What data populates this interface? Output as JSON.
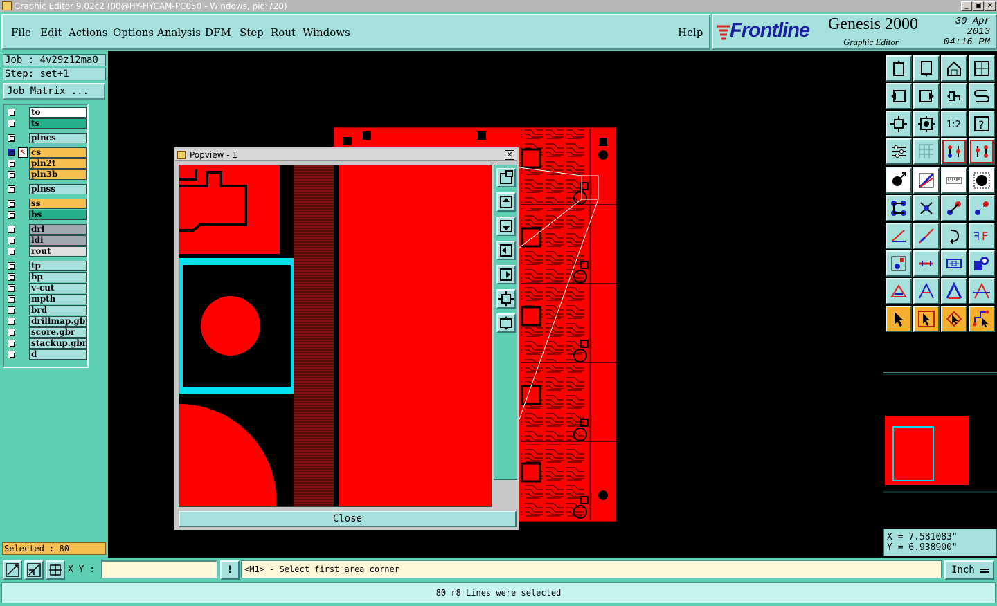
{
  "window": {
    "title": "Graphic Editor 9.02c2 (00@HY-HYCAM-PC050 - Windows, pid:720)",
    "min": "_",
    "max": "▣",
    "close": "✕"
  },
  "menu": {
    "items": [
      "File",
      "Edit",
      "Actions",
      "Options",
      "Analysis",
      "DFM",
      "Step",
      "Rout",
      "Windows"
    ],
    "help": "Help"
  },
  "brand": {
    "logo": "Frontline",
    "product": "Genesis 2000",
    "subtitle": "Graphic Editor",
    "date": "30 Apr 2013",
    "time": "04:16 PM"
  },
  "job": {
    "job_line": "Job : 4v29z12ma0",
    "step_line": "Step: set+1",
    "matrix_button": "Job Matrix ..."
  },
  "layers": [
    {
      "name": "to",
      "color": "#ffffff"
    },
    {
      "name": "ts",
      "color": "#23b08a"
    },
    {
      "name": "plncs",
      "color": "#a5e0dc"
    },
    {
      "name": "cs",
      "color": "#f6c050"
    },
    {
      "name": "pln2t",
      "color": "#f6c050"
    },
    {
      "name": "pln3b",
      "color": "#f6c050"
    },
    {
      "name": "plnss",
      "color": "#a5e0dc"
    },
    {
      "name": "ss",
      "color": "#f6c050"
    },
    {
      "name": "bs",
      "color": "#23b08a"
    },
    {
      "name": "drl",
      "color": "#a0a8b0"
    },
    {
      "name": "ldi",
      "color": "#a0a8b0"
    },
    {
      "name": "rout",
      "color": "#e0e0e0"
    },
    {
      "name": "tp",
      "color": "#a5e0dc"
    },
    {
      "name": "bp",
      "color": "#a5e0dc"
    },
    {
      "name": "v-cut",
      "color": "#a5e0dc"
    },
    {
      "name": "mpth",
      "color": "#a5e0dc"
    },
    {
      "name": "brd",
      "color": "#a5e0dc"
    },
    {
      "name": "drillmap.gbr",
      "color": "#a5e0dc"
    },
    {
      "name": "score.gbr",
      "color": "#a5e0dc"
    },
    {
      "name": "stackup.gbr",
      "color": "#a5e0dc"
    },
    {
      "name": "d",
      "color": "#a5e0dc"
    }
  ],
  "selected_count": "Selected : 80",
  "popview": {
    "title": "Popview - 1",
    "close_x": "✕",
    "close_button": "Close"
  },
  "coords": {
    "x": "X = 7.581083\"",
    "y": "Y = 6.938900\""
  },
  "bottom": {
    "xy_label": "X Y :",
    "xy_value": "",
    "bang": "!",
    "prompt": "<M1> - Select first area corner",
    "unit": "Inch"
  },
  "status": "80 r8 Lines were selected",
  "colors": {
    "panel": "#5fcfb4",
    "panel_light": "#a5e0dc",
    "copper": "#ff0000",
    "highlight": "#00e0f0"
  }
}
